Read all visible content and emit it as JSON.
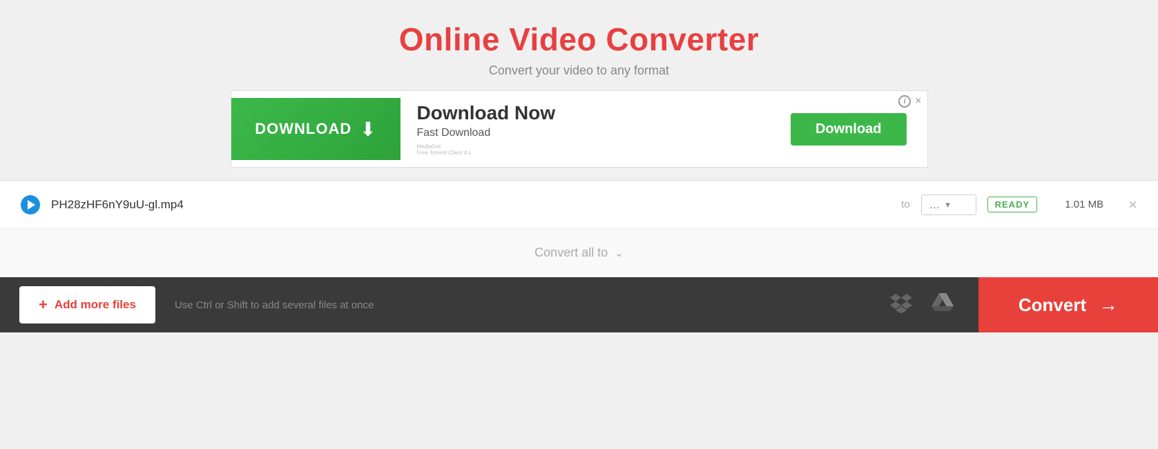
{
  "header": {
    "title": "Online Video Converter",
    "subtitle": "Convert your video to any format"
  },
  "ad": {
    "download_label": "DOWNLOAD",
    "now_title": "Download Now",
    "fast_label": "Fast Download",
    "watermark": "MediaGet\nFree Torrent Client 4.x",
    "download_btn": "Download",
    "info_icon": "i",
    "close_icon": "×"
  },
  "file_row": {
    "filename": "PH28zHF6nY9uU-gl.mp4",
    "to_label": "to",
    "format_dots": "...",
    "ready_badge": "READY",
    "file_size": "1.01 MB",
    "close_btn": "×"
  },
  "convert_all": {
    "label": "Convert all to",
    "chevron": "⌄"
  },
  "bottom_bar": {
    "add_plus": "+",
    "add_label": "Add more files",
    "hint": "Use Ctrl or Shift to add several files at once",
    "convert_label": "Convert",
    "arrow": "→"
  }
}
